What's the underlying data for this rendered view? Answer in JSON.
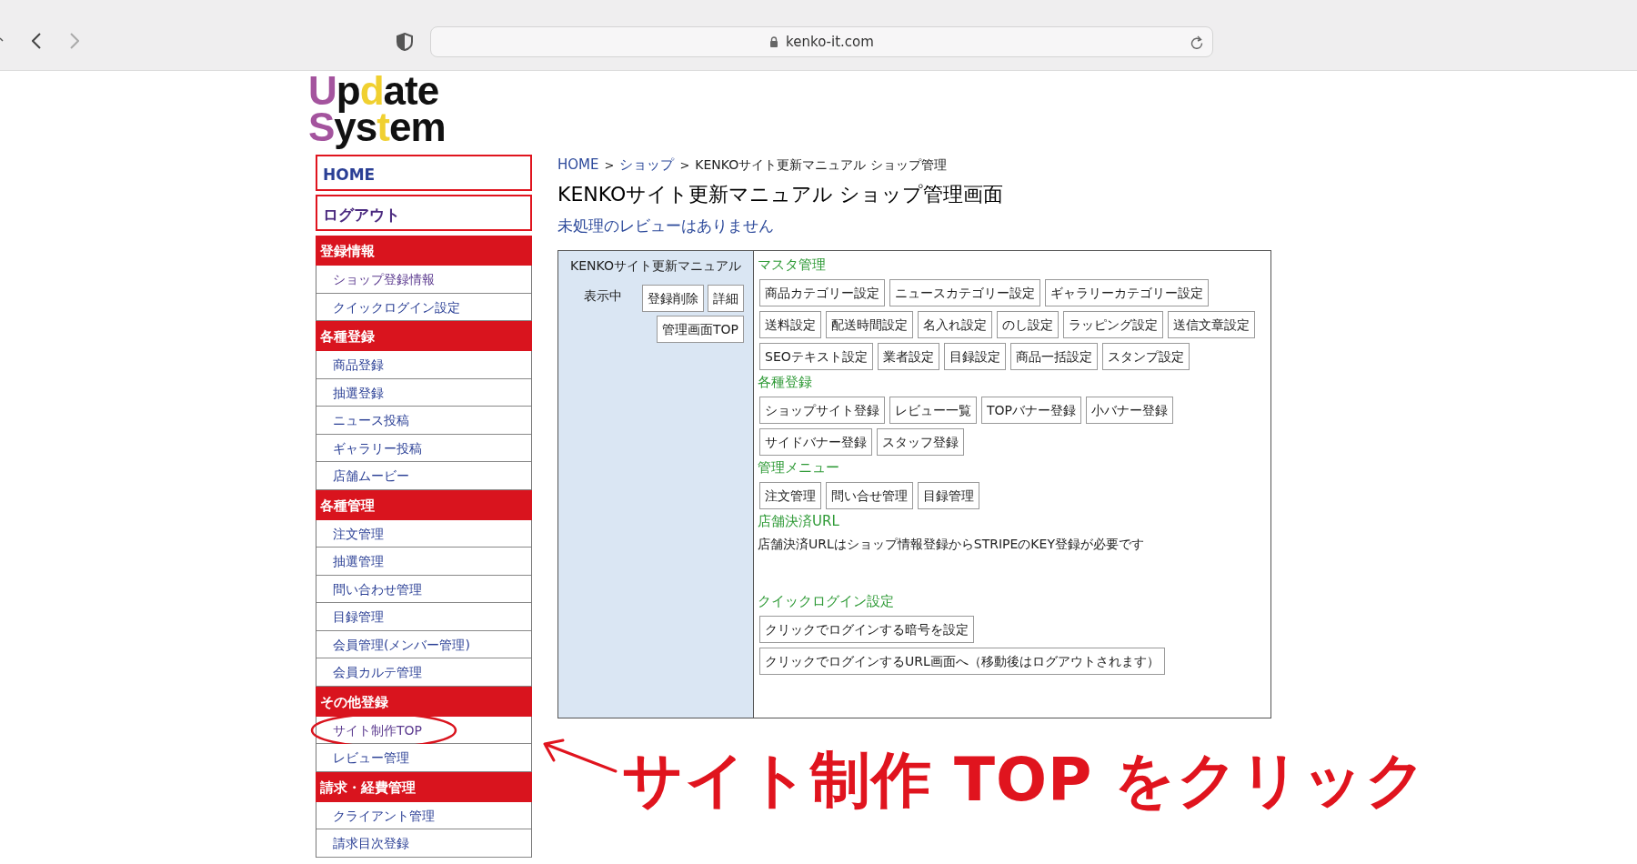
{
  "browser": {
    "url": "kenko-it.com"
  },
  "logo": {
    "lines": [
      [
        {
          "text": "U",
          "color": "#a4549e"
        },
        {
          "text": "p",
          "color": "#111111"
        },
        {
          "text": "d",
          "color": "#f0d030"
        },
        {
          "text": "ate",
          "color": "#111111"
        }
      ],
      [
        {
          "text": "S",
          "color": "#a4549e"
        },
        {
          "text": "ys",
          "color": "#111111"
        },
        {
          "text": "t",
          "color": "#f0d030"
        },
        {
          "text": "em",
          "color": "#111111"
        }
      ]
    ]
  },
  "nav": [
    {
      "label": "HOME",
      "visited": false
    },
    {
      "label": "ログアウト",
      "visited": true
    }
  ],
  "sidebar": {
    "sections": [
      {
        "title": "登録情報",
        "items": [
          {
            "label": "ショップ登録情報",
            "visited": true,
            "circled": false
          },
          {
            "label": "クイックログイン設定",
            "visited": false,
            "circled": false
          }
        ]
      },
      {
        "title": "各種登録",
        "items": [
          {
            "label": "商品登録",
            "visited": false,
            "circled": false
          },
          {
            "label": "抽選登録",
            "visited": false,
            "circled": false
          },
          {
            "label": "ニュース投稿",
            "visited": false,
            "circled": false
          },
          {
            "label": "ギャラリー投稿",
            "visited": false,
            "circled": false
          },
          {
            "label": "店舗ムービー",
            "visited": false,
            "circled": false
          }
        ]
      },
      {
        "title": "各種管理",
        "items": [
          {
            "label": "注文管理",
            "visited": false,
            "circled": false
          },
          {
            "label": "抽選管理",
            "visited": false,
            "circled": false
          },
          {
            "label": "問い合わせ管理",
            "visited": false,
            "circled": false
          },
          {
            "label": "目録管理",
            "visited": false,
            "circled": false
          },
          {
            "label": "会員管理(メンバー管理)",
            "visited": false,
            "circled": false
          },
          {
            "label": "会員カルテ管理",
            "visited": false,
            "circled": false
          }
        ]
      },
      {
        "title": "その他登録",
        "items": [
          {
            "label": "サイト制作TOP",
            "visited": true,
            "circled": true
          },
          {
            "label": "レビュー管理",
            "visited": false,
            "circled": false
          }
        ]
      },
      {
        "title": "請求・経費管理",
        "items": [
          {
            "label": "クライアント管理",
            "visited": false,
            "circled": false
          },
          {
            "label": "請求目次登録",
            "visited": false,
            "circled": false
          }
        ]
      }
    ]
  },
  "breadcrumb": [
    {
      "kind": "link",
      "text": "HOME"
    },
    {
      "kind": "separator",
      "text": ">"
    },
    {
      "kind": "link",
      "text": "ショップ"
    },
    {
      "kind": "separator",
      "text": ">"
    },
    {
      "kind": "current",
      "text": "KENKOサイト更新マニュアル ショップ管理"
    }
  ],
  "page_title": "KENKOサイト更新マニュアル ショップ管理画面",
  "review_notice": "未処理のレビューはありません",
  "shop_panel": {
    "name": "KENKOサイト更新マニュアル",
    "status": "表示中",
    "buttons": [
      "登録削除",
      "詳細",
      "管理画面TOP"
    ]
  },
  "menu_sections": [
    {
      "title": "マスタ管理",
      "kind": "buttons",
      "buttons": [
        "商品カテゴリー設定",
        "ニュースカテゴリー設定",
        "ギャラリーカテゴリー設定",
        "送料設定",
        "配送時間設定",
        "名入れ設定",
        "のし設定",
        "ラッピング設定",
        "送信文章設定",
        "SEOテキスト設定",
        "業者設定",
        "目録設定",
        "商品一括設定",
        "スタンプ設定"
      ]
    },
    {
      "title": "各種登録",
      "kind": "buttons",
      "buttons": [
        "ショップサイト登録",
        "レビュー一覧",
        "TOPバナー登録",
        "小バナー登録",
        "サイドバナー登録",
        "スタッフ登録"
      ]
    },
    {
      "title": "管理メニュー",
      "kind": "buttons",
      "buttons": [
        "注文管理",
        "問い合せ管理",
        "目録管理"
      ]
    },
    {
      "title": "店舗決済URL",
      "kind": "note",
      "note": "店舗決済URLはショップ情報登録からSTRIPEのKEY登録が必要です"
    },
    {
      "title": "クイックログイン設定",
      "kind": "buttons",
      "buttons": [
        "クリックでログインする暗号を設定",
        "クリックでログインするURL画面へ（移動後はログアウトされます）"
      ]
    }
  ],
  "annotation": {
    "callout": "サイト制作 TOP をクリック"
  }
}
